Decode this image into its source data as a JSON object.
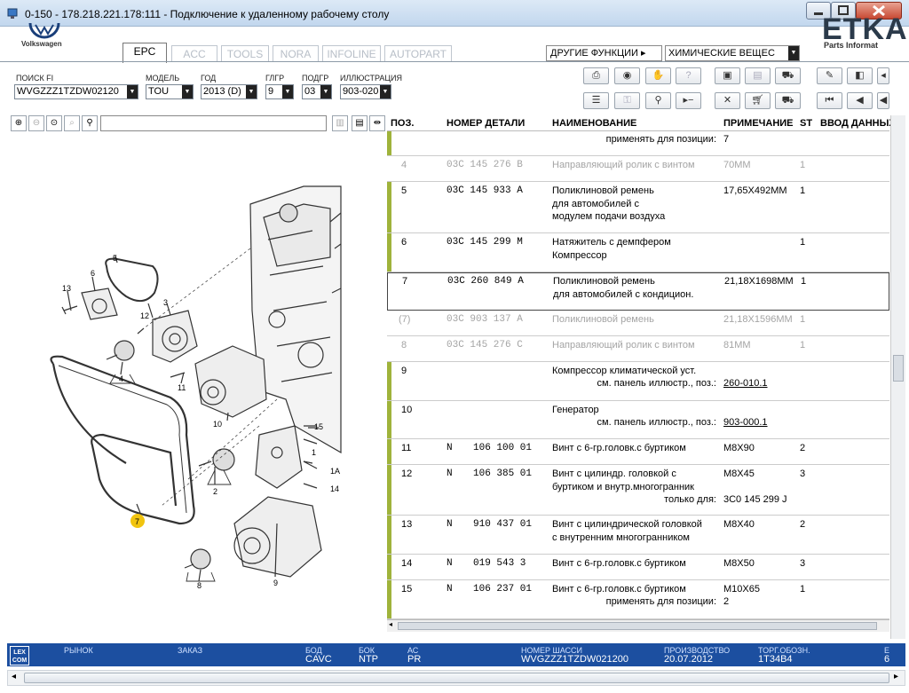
{
  "window": {
    "title": "0-150 - 178.218.221.178:111 - Подключение к удаленному рабочему столу"
  },
  "brand": {
    "vw_name": "Volkswagen",
    "etka_logo": "ETKA",
    "etka_sub": "Parts Informat"
  },
  "tabs": [
    {
      "label": "EPC",
      "active": true
    },
    {
      "label": "ACC",
      "active": false
    },
    {
      "label": "TOOLS",
      "active": false
    },
    {
      "label": "NORA",
      "active": false
    },
    {
      "label": "INFOLINE",
      "active": false
    },
    {
      "label": "AUTOPART",
      "active": false
    }
  ],
  "header": {
    "other_functions": "ДРУГИЕ ФУНКЦИИ ▸",
    "chem_select": "ХИМИЧЕСКИЕ ВЕЩЕС"
  },
  "filters": {
    "search_fi": {
      "label": "ПОИСК FI",
      "value": "WVGZZZ1TZDW02120"
    },
    "model": {
      "label": "МОДЕЛЬ",
      "value": "TOU"
    },
    "year": {
      "label": "ГОД",
      "value": "2013 (D)"
    },
    "main_group": {
      "label": "ГЛГР",
      "value": "9"
    },
    "sub_group": {
      "label": "ПОДГР",
      "value": "03"
    },
    "illustration": {
      "label": "ИЛЛЮСТРАЦИЯ",
      "value": "903-020"
    }
  },
  "table": {
    "headers": {
      "pos": "ПОЗ.",
      "part": "НОМЕР ДЕТАЛИ",
      "name": "НАИМЕНОВАНИЕ",
      "note": "ПРИМЕЧАНИЕ",
      "st": "ST",
      "input": "ВВОД ДАННЫХ"
    },
    "rows": [
      {
        "pos": "",
        "n": "",
        "part": "",
        "name": "применять для позиции:",
        "note": "7",
        "st": ""
      },
      {
        "pos": "4",
        "n": "",
        "part": "03C 145 276 B",
        "name": "Направляющий ролик с винтом",
        "note": "70MM",
        "st": "1"
      },
      {
        "pos": "5",
        "n": "",
        "part": "03C 145 933 A",
        "name": "Поликлиновой ремень\nдля автомобилей с\nмодулем подачи воздуха",
        "note": "17,65X492MM",
        "st": "1"
      },
      {
        "pos": "6",
        "n": "",
        "part": "03C 145 299 M",
        "name": "Натяжитель с демпфером\nКомпрессор",
        "note": "",
        "st": "1"
      },
      {
        "pos": "7",
        "n": "",
        "part": "03C 260 849 A",
        "name": "Поликлиновой ремень\nдля автомобилей с кондицион.",
        "note": "21,18X1698MM",
        "st": "1"
      },
      {
        "pos": "(7)",
        "n": "",
        "part": "03C 903 137 A",
        "name": "Поликлиновой ремень",
        "note": "21,18X1596MM",
        "st": "1"
      },
      {
        "pos": "8",
        "n": "",
        "part": "03C 145 276 C",
        "name": "Направляющий ролик с винтом",
        "note": "81MM",
        "st": "1"
      },
      {
        "pos": "9",
        "n": "",
        "part": "",
        "name": "Компрессор климатической уст.",
        "name2": "см. панель иллюстр., поз.:",
        "note": "260-010.1",
        "st": ""
      },
      {
        "pos": "10",
        "n": "",
        "part": "",
        "name": "Генератор",
        "name2": "см. панель иллюстр., поз.:",
        "note": "903-000.1",
        "st": ""
      },
      {
        "pos": "11",
        "n": "N",
        "part": "106 100 01",
        "name": "Винт с 6-гр.головк.с буртиком",
        "note": "M8X90",
        "st": "2"
      },
      {
        "pos": "12",
        "n": "N",
        "part": "106 385 01",
        "name": "Винт с цилиндр. головкой с\nбуртиком и внутр.многогранник",
        "name2": "только для:",
        "note": "M8X45",
        "note2": "3C0 145 299 J",
        "st": "3"
      },
      {
        "pos": "13",
        "n": "N",
        "part": "910 437 01",
        "name": "Винт с цилиндрической головкой\nс внутренним многогранником",
        "note": "M8X40",
        "st": "2"
      },
      {
        "pos": "14",
        "n": "N",
        "part": "019 543 3",
        "name": "Винт с 6-гр.головк.с буртиком",
        "note": "M8X50",
        "st": "3"
      },
      {
        "pos": "15",
        "n": "N",
        "part": "106 237 01",
        "name": "Винт с 6-гр.головк.с буртиком",
        "name2": "применять для позиции:",
        "note": "M10X65",
        "note2": "2",
        "st": "1"
      }
    ]
  },
  "illustration": {
    "callouts": [
      "5",
      "6",
      "13",
      "12",
      "3",
      "4",
      "11",
      "10",
      "15",
      "1",
      "1A",
      "14",
      "2",
      "7",
      "8",
      "9"
    ],
    "highlight_color": "#f1c40f"
  },
  "status": {
    "logo": "LEX\nCOM",
    "market_label": "РЫНОК",
    "order_label": "ЗАКАЗ",
    "bod_label": "БОД",
    "bod_value": "CAVC",
    "bok_label": "БОК",
    "bok_value": "NTP",
    "ac_label": "АС",
    "ac_value": "PR",
    "vin_label": "НОМЕР ШАССИ",
    "vin_value": "WVGZZZ1TZDW021200",
    "prod_label": "ПРОИЗВОДСТВО",
    "prod_value": "20.07.2012",
    "trade_label": "ТОРГ.ОБОЗН.",
    "trade_value": "1T34B4",
    "edge_label": "Е",
    "edge_value": "6"
  },
  "colors": {
    "status_bg": "#1c4fa0",
    "row_bar": "#9fb33b",
    "title_bg": "#c2d7ee"
  }
}
